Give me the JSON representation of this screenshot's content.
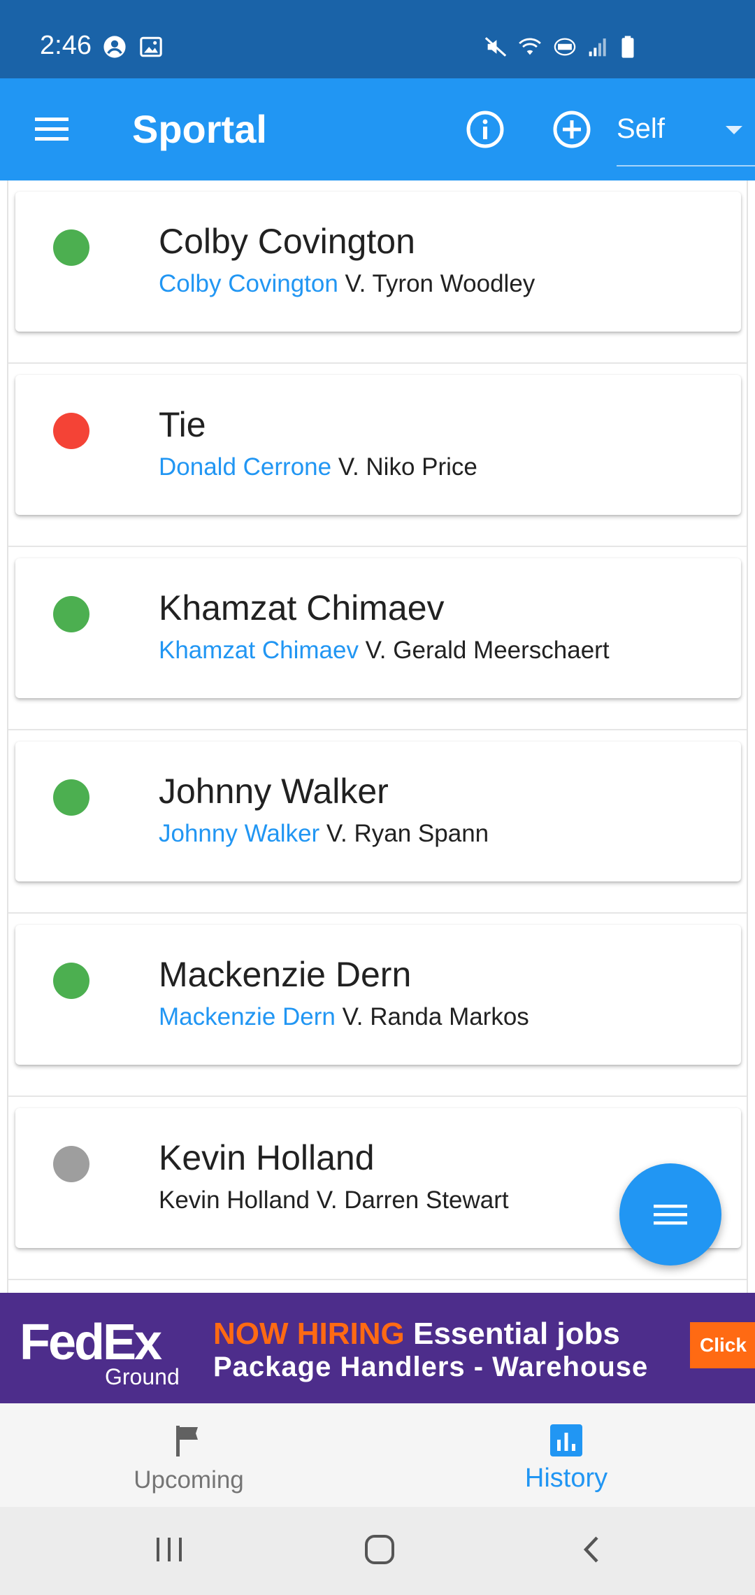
{
  "status_bar": {
    "time": "2:46"
  },
  "app_bar": {
    "title": "Sportal",
    "profile_select": {
      "value": "Self"
    }
  },
  "fights": [
    {
      "title": "Colby Covington",
      "fighter_a": "Colby Covington",
      "separator": " V. ",
      "fighter_b": "Tyron Woodley",
      "status": "correct",
      "status_color": "#4caf50",
      "winner_highlighted": true
    },
    {
      "title": "Tie",
      "fighter_a": "Donald Cerrone",
      "separator": " V. ",
      "fighter_b": "Niko Price",
      "status": "incorrect",
      "status_color": "#f44336",
      "winner_highlighted": true
    },
    {
      "title": "Khamzat Chimaev",
      "fighter_a": "Khamzat Chimaev",
      "separator": " V. ",
      "fighter_b": "Gerald Meerschaert",
      "status": "correct",
      "status_color": "#4caf50",
      "winner_highlighted": true
    },
    {
      "title": "Johnny Walker",
      "fighter_a": "Johnny Walker",
      "separator": " V. ",
      "fighter_b": "Ryan Spann",
      "status": "correct",
      "status_color": "#4caf50",
      "winner_highlighted": true
    },
    {
      "title": "Mackenzie Dern",
      "fighter_a": "Mackenzie Dern",
      "separator": " V. ",
      "fighter_b": "Randa Markos",
      "status": "correct",
      "status_color": "#4caf50",
      "winner_highlighted": true
    },
    {
      "title": "Kevin Holland",
      "fighter_a": "Kevin Holland",
      "separator": " V. ",
      "fighter_b": "Darren Stewart",
      "status": "pending",
      "status_color": "#9e9e9e",
      "winner_highlighted": false
    }
  ],
  "ad": {
    "logo": "FedEx",
    "logo_sub": "Ground",
    "highlight": "NOW HIRING",
    "line1_rest": " Essential jobs",
    "line2": "Package Handlers - Warehouse",
    "cta": "Click"
  },
  "bottom_nav": {
    "tabs": [
      {
        "label": "Upcoming",
        "icon": "flag-icon",
        "active": false
      },
      {
        "label": "History",
        "icon": "bar-chart-icon",
        "active": true
      }
    ]
  },
  "colors": {
    "primary": "#2196f3",
    "status_bar": "#1a63a8",
    "ad_background": "#4d2d8b",
    "ad_accent": "#ff6a13"
  }
}
